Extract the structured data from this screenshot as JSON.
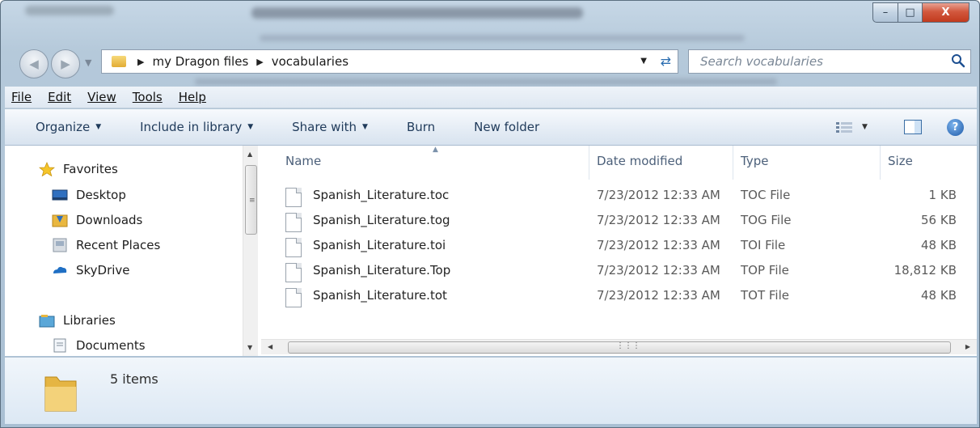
{
  "window": {
    "caption_buttons": {
      "minimize": "–",
      "maximize": "□",
      "close": "X"
    }
  },
  "address": {
    "crumbs": [
      "my Dragon files",
      "vocabularies"
    ]
  },
  "search": {
    "placeholder": "Search vocabularies"
  },
  "menu": {
    "file": "File",
    "edit": "Edit",
    "view": "View",
    "tools": "Tools",
    "help": "Help"
  },
  "toolbar": {
    "organize": "Organize",
    "include_in_library": "Include in library",
    "share_with": "Share with",
    "burn": "Burn",
    "new_folder": "New folder"
  },
  "nav": {
    "favorites": "Favorites",
    "desktop": "Desktop",
    "downloads": "Downloads",
    "recent_places": "Recent Places",
    "skydrive": "SkyDrive",
    "libraries": "Libraries",
    "documents": "Documents"
  },
  "columns": {
    "name": "Name",
    "date": "Date modified",
    "type": "Type",
    "size": "Size"
  },
  "files": [
    {
      "name": "Spanish_Literature.toc",
      "date": "7/23/2012 12:33 AM",
      "type": "TOC File",
      "size": "1 KB"
    },
    {
      "name": "Spanish_Literature.tog",
      "date": "7/23/2012 12:33 AM",
      "type": "TOG File",
      "size": "56 KB"
    },
    {
      "name": "Spanish_Literature.toi",
      "date": "7/23/2012 12:33 AM",
      "type": "TOI File",
      "size": "48 KB"
    },
    {
      "name": "Spanish_Literature.Top",
      "date": "7/23/2012 12:33 AM",
      "type": "TOP File",
      "size": "18,812 KB"
    },
    {
      "name": "Spanish_Literature.tot",
      "date": "7/23/2012 12:33 AM",
      "type": "TOT File",
      "size": "48 KB"
    }
  ],
  "details": {
    "count": "5 items"
  },
  "colors": {
    "accent": "#1f3a5a",
    "close": "#c23a1d",
    "folder": "#e2ac35"
  },
  "icons": {
    "back": "arrow-left-icon",
    "forward": "arrow-right-icon",
    "search": "search-icon",
    "refresh": "refresh-icon",
    "views": "views-icon",
    "preview": "preview-pane-icon",
    "help": "help-icon"
  }
}
